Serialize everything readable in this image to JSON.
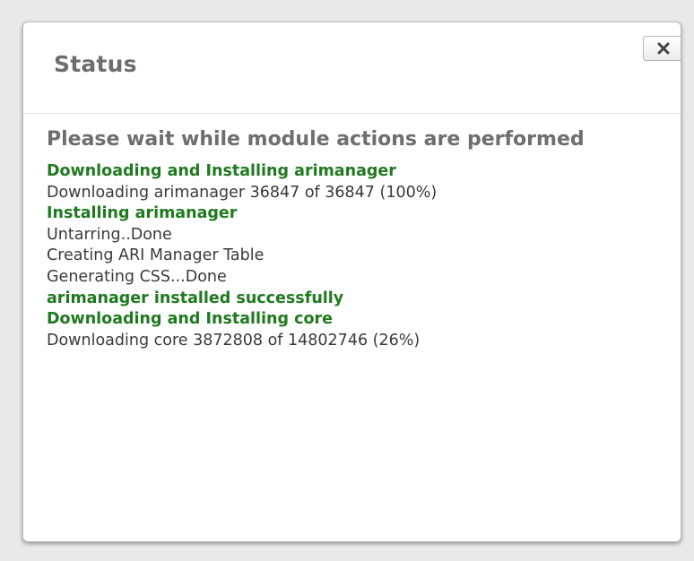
{
  "dialog": {
    "title": "Status",
    "close_icon": "close-x-icon",
    "heading": "Please wait while module actions are performed",
    "log": [
      {
        "text": "Downloading and Installing arimanager",
        "emphasis": true
      },
      {
        "text": "Downloading arimanager 36847 of 36847 (100%)",
        "emphasis": false
      },
      {
        "text": "Installing arimanager",
        "emphasis": true
      },
      {
        "text": "Untarring..Done",
        "emphasis": false
      },
      {
        "text": "Creating ARI Manager Table",
        "emphasis": false
      },
      {
        "text": "Generating CSS...Done",
        "emphasis": false
      },
      {
        "text": "arimanager installed successfully",
        "emphasis": true
      },
      {
        "text": "Downloading and Installing core",
        "emphasis": true
      },
      {
        "text": "Downloading core 3872808 of 14802746 (26%)",
        "emphasis": false
      }
    ]
  },
  "colors": {
    "success_green": "#1f7a1f",
    "heading_gray": "#6e6e6e",
    "text_dark": "#3a3a3a",
    "backdrop": "#e9e9e9"
  }
}
